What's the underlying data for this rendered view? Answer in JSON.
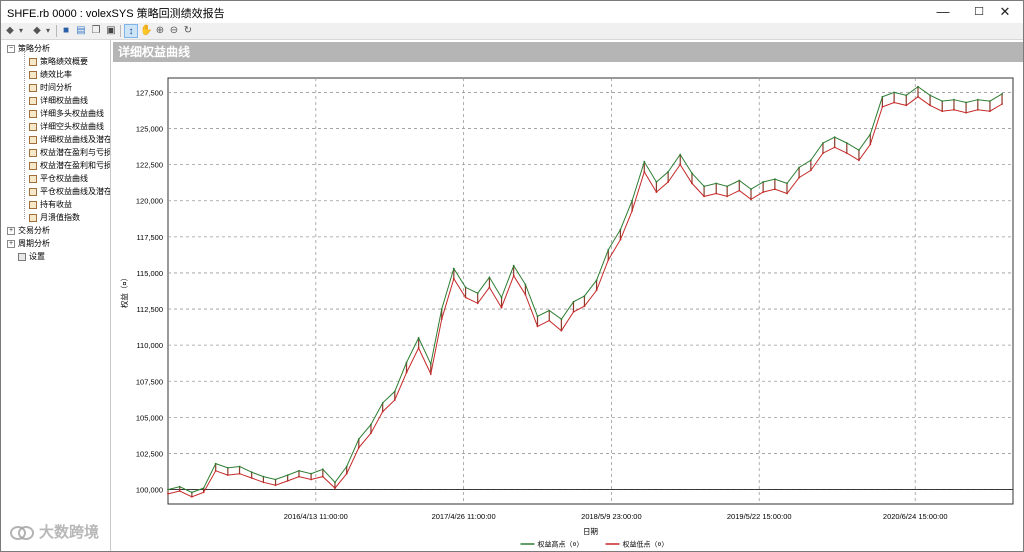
{
  "window": {
    "title": "SHFE.rb 0000 : volexSYS 策略回测绩效报告",
    "minimize": "—",
    "maximize": "☐",
    "close": "✕"
  },
  "toolbar": {
    "icons": [
      "back-arrow-icon",
      "dropdown-icon",
      "forward-arrow-icon",
      "dropdown-icon",
      "save-icon",
      "export-icon",
      "copy-icon",
      "print-icon",
      "pointer-icon",
      "hand-pan-icon",
      "zoom-in-icon",
      "zoom-out-icon",
      "refresh-icon"
    ]
  },
  "sidebar": {
    "groups": [
      {
        "label": "策略分析",
        "expanded": true,
        "items": [
          "策略绩效概要",
          "绩效比率",
          "时间分析",
          "详细权益曲线",
          "详细多头权益曲线",
          "详细空头权益曲线",
          "详细权益曲线及潜在",
          "权益潜在盈利与亏损",
          "权益潜在盈利和亏损",
          "平仓权益曲线",
          "平仓权益曲线及潜在",
          "持有收益",
          "月溃值指数"
        ]
      },
      {
        "label": "交易分析",
        "expanded": false,
        "items": []
      },
      {
        "label": "周期分析",
        "expanded": false,
        "items": []
      }
    ],
    "settings": "设置"
  },
  "panel": {
    "header": "详细权益曲线"
  },
  "chart_data": {
    "type": "line",
    "xlabel": "日期",
    "ylabel": "权益（¤）",
    "ylim": [
      99000,
      128500
    ],
    "y_ticks": [
      100000,
      102500,
      105000,
      107500,
      110000,
      112500,
      115000,
      117500,
      120000,
      122500,
      125000,
      127500
    ],
    "y_tick_labels": [
      "100,000",
      "102,500",
      "105,000",
      "107,500",
      "110,000",
      "112,500",
      "115,000",
      "117,500",
      "120,000",
      "122,500",
      "125,000",
      "127,500"
    ],
    "x_range": [
      "2015/4/1",
      "2021/3/1"
    ],
    "x_ticks": [
      "2016/4/13",
      "2017/4/26",
      "2018/5/9",
      "2019/5/22",
      "2020/6/24"
    ],
    "x_tick_labels": [
      "2016/4/13 11:00:00",
      "2017/4/26 11:00:00",
      "2018/5/9 23:00:00",
      "2019/5/22 15:00:00",
      "2020/6/24 15:00:00"
    ],
    "grid": true,
    "baseline": 100000,
    "legend": {
      "placement": "bottom-center",
      "entries": [
        "权益高点（¤）",
        "权益低点（¤）"
      ]
    },
    "series": [
      {
        "name": "权益高点（¤）",
        "color": "#2e7d32",
        "points": [
          [
            "2015/4/1",
            100000
          ],
          [
            "2015/5/1",
            100200
          ],
          [
            "2015/6/1",
            99800
          ],
          [
            "2015/7/1",
            100100
          ],
          [
            "2015/8/1",
            101800
          ],
          [
            "2015/9/1",
            101500
          ],
          [
            "2015/10/1",
            101600
          ],
          [
            "2015/11/1",
            101200
          ],
          [
            "2015/12/1",
            100900
          ],
          [
            "2016/1/1",
            100700
          ],
          [
            "2016/2/1",
            101000
          ],
          [
            "2016/3/1",
            101300
          ],
          [
            "2016/4/1",
            101100
          ],
          [
            "2016/5/1",
            101400
          ],
          [
            "2016/6/1",
            100500
          ],
          [
            "2016/7/1",
            101600
          ],
          [
            "2016/8/1",
            103500
          ],
          [
            "2016/9/1",
            104500
          ],
          [
            "2016/10/1",
            106000
          ],
          [
            "2016/11/1",
            106800
          ],
          [
            "2016/12/1",
            108800
          ],
          [
            "2017/1/1",
            110500
          ],
          [
            "2017/2/1",
            108700
          ],
          [
            "2017/3/1",
            112500
          ],
          [
            "2017/4/1",
            115300
          ],
          [
            "2017/5/1",
            114000
          ],
          [
            "2017/6/1",
            113600
          ],
          [
            "2017/7/1",
            114700
          ],
          [
            "2017/8/1",
            113300
          ],
          [
            "2017/9/1",
            115500
          ],
          [
            "2017/10/1",
            114200
          ],
          [
            "2017/11/1",
            112000
          ],
          [
            "2017/12/1",
            112400
          ],
          [
            "2018/1/1",
            111800
          ],
          [
            "2018/2/1",
            113000
          ],
          [
            "2018/3/1",
            113400
          ],
          [
            "2018/4/1",
            114500
          ],
          [
            "2018/5/1",
            116600
          ],
          [
            "2018/6/1",
            118000
          ],
          [
            "2018/7/1",
            120000
          ],
          [
            "2018/8/1",
            122700
          ],
          [
            "2018/9/1",
            121300
          ],
          [
            "2018/10/1",
            122000
          ],
          [
            "2018/11/1",
            123200
          ],
          [
            "2018/12/1",
            121900
          ],
          [
            "2019/1/1",
            121000
          ],
          [
            "2019/2/1",
            121200
          ],
          [
            "2019/3/1",
            121000
          ],
          [
            "2019/4/1",
            121400
          ],
          [
            "2019/5/1",
            120800
          ],
          [
            "2019/6/1",
            121300
          ],
          [
            "2019/7/1",
            121500
          ],
          [
            "2019/8/1",
            121200
          ],
          [
            "2019/9/1",
            122300
          ],
          [
            "2019/10/1",
            122800
          ],
          [
            "2019/11/1",
            124000
          ],
          [
            "2019/12/1",
            124400
          ],
          [
            "2020/1/1",
            124000
          ],
          [
            "2020/2/1",
            123500
          ],
          [
            "2020/3/1",
            124600
          ],
          [
            "2020/4/1",
            127200
          ],
          [
            "2020/5/1",
            127500
          ],
          [
            "2020/6/1",
            127300
          ],
          [
            "2020/7/1",
            127900
          ],
          [
            "2020/8/1",
            127300
          ],
          [
            "2020/9/1",
            126900
          ],
          [
            "2020/10/1",
            127000
          ],
          [
            "2020/11/1",
            126800
          ],
          [
            "2020/12/1",
            127000
          ],
          [
            "2021/1/1",
            126900
          ],
          [
            "2021/2/1",
            127400
          ]
        ]
      },
      {
        "name": "权益低点（¤）",
        "color": "#c62828",
        "points": [
          [
            "2015/4/1",
            99700
          ],
          [
            "2015/5/1",
            99900
          ],
          [
            "2015/6/1",
            99500
          ],
          [
            "2015/7/1",
            99800
          ],
          [
            "2015/8/1",
            101300
          ],
          [
            "2015/9/1",
            101000
          ],
          [
            "2015/10/1",
            101100
          ],
          [
            "2015/11/1",
            100800
          ],
          [
            "2015/12/1",
            100500
          ],
          [
            "2016/1/1",
            100300
          ],
          [
            "2016/2/1",
            100600
          ],
          [
            "2016/3/1",
            100900
          ],
          [
            "2016/4/1",
            100700
          ],
          [
            "2016/5/1",
            100900
          ],
          [
            "2016/6/1",
            100100
          ],
          [
            "2016/7/1",
            101100
          ],
          [
            "2016/8/1",
            102900
          ],
          [
            "2016/9/1",
            103900
          ],
          [
            "2016/10/1",
            105400
          ],
          [
            "2016/11/1",
            106200
          ],
          [
            "2016/12/1",
            108100
          ],
          [
            "2017/1/1",
            109800
          ],
          [
            "2017/2/1",
            108000
          ],
          [
            "2017/3/1",
            111800
          ],
          [
            "2017/4/1",
            114600
          ],
          [
            "2017/5/1",
            113300
          ],
          [
            "2017/6/1",
            112900
          ],
          [
            "2017/7/1",
            114000
          ],
          [
            "2017/8/1",
            112600
          ],
          [
            "2017/9/1",
            114800
          ],
          [
            "2017/10/1",
            113500
          ],
          [
            "2017/11/1",
            111300
          ],
          [
            "2017/12/1",
            111700
          ],
          [
            "2018/1/1",
            111000
          ],
          [
            "2018/2/1",
            112300
          ],
          [
            "2018/3/1",
            112700
          ],
          [
            "2018/4/1",
            113800
          ],
          [
            "2018/5/1",
            115900
          ],
          [
            "2018/6/1",
            117300
          ],
          [
            "2018/7/1",
            119300
          ],
          [
            "2018/8/1",
            122000
          ],
          [
            "2018/9/1",
            120600
          ],
          [
            "2018/10/1",
            121300
          ],
          [
            "2018/11/1",
            122500
          ],
          [
            "2018/12/1",
            121200
          ],
          [
            "2019/1/1",
            120300
          ],
          [
            "2019/2/1",
            120500
          ],
          [
            "2019/3/1",
            120300
          ],
          [
            "2019/4/1",
            120700
          ],
          [
            "2019/5/1",
            120100
          ],
          [
            "2019/6/1",
            120600
          ],
          [
            "2019/7/1",
            120800
          ],
          [
            "2019/8/1",
            120500
          ],
          [
            "2019/9/1",
            121600
          ],
          [
            "2019/10/1",
            122100
          ],
          [
            "2019/11/1",
            123300
          ],
          [
            "2019/12/1",
            123700
          ],
          [
            "2020/1/1",
            123300
          ],
          [
            "2020/2/1",
            122800
          ],
          [
            "2020/3/1",
            123900
          ],
          [
            "2020/4/1",
            126500
          ],
          [
            "2020/5/1",
            126800
          ],
          [
            "2020/6/1",
            126600
          ],
          [
            "2020/7/1",
            127200
          ],
          [
            "2020/8/1",
            126600
          ],
          [
            "2020/9/1",
            126200
          ],
          [
            "2020/10/1",
            126300
          ],
          [
            "2020/11/1",
            126100
          ],
          [
            "2020/12/1",
            126300
          ],
          [
            "2021/1/1",
            126200
          ],
          [
            "2021/2/1",
            126700
          ]
        ]
      }
    ]
  },
  "watermark": "大数跨境"
}
